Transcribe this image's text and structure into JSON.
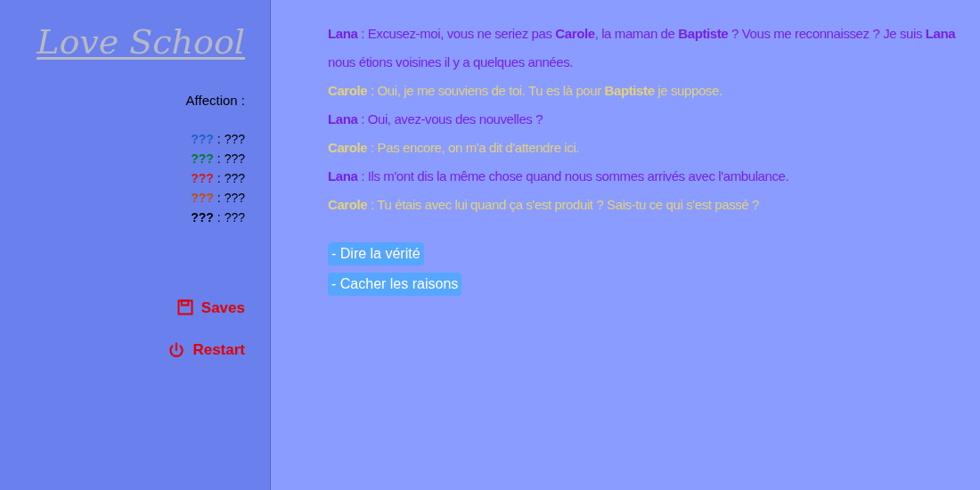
{
  "sidebar": {
    "title": "Love School",
    "affection_label": "Affection :",
    "affection": [
      {
        "name": "???",
        "separator": ":",
        "value": "???",
        "color": "#1e5fc8"
      },
      {
        "name": "???",
        "separator": ":",
        "value": "???",
        "color": "#007a2a"
      },
      {
        "name": "???",
        "separator": ":",
        "value": "???",
        "color": "#d41a10"
      },
      {
        "name": "???",
        "separator": ":",
        "value": "???",
        "color": "#c84a00"
      },
      {
        "name": "???",
        "separator": ":",
        "value": "???",
        "color": "#000000"
      }
    ],
    "menu": [
      {
        "kind": "saves",
        "label": "Saves"
      },
      {
        "kind": "restart",
        "label": "Restart"
      }
    ]
  },
  "dialogue": [
    {
      "kind": "lana",
      "text": "**Lana** : Excusez-moi, vous ne seriez pas **Carole**, la maman de **Baptiste** ? Vous me reconnaissez ? Je suis **Lana** nous étions voisines il y a quelques années."
    },
    {
      "kind": "carole",
      "text": "**Carole** : Oui, je me souviens de toi. Tu es là pour **Baptiste** je suppose."
    },
    {
      "kind": "lana",
      "text": "**Lana** : Oui, avez-vous des nouvelles ?"
    },
    {
      "kind": "carole",
      "text": "**Carole** : Pas encore, on m'a dit d'attendre ici."
    },
    {
      "kind": "lana",
      "text": "**Lana** : Ils m'ont dis la même chose quand nous sommes arrivés avec l'ambulance."
    },
    {
      "kind": "carole",
      "text": "**Carole** : Tu étais avec lui quand ça s'est produit ? Sais-tu ce qui s'est passé ?"
    }
  ],
  "choices": [
    "- Dire la vérité",
    "- Cacher les raisons"
  ]
}
